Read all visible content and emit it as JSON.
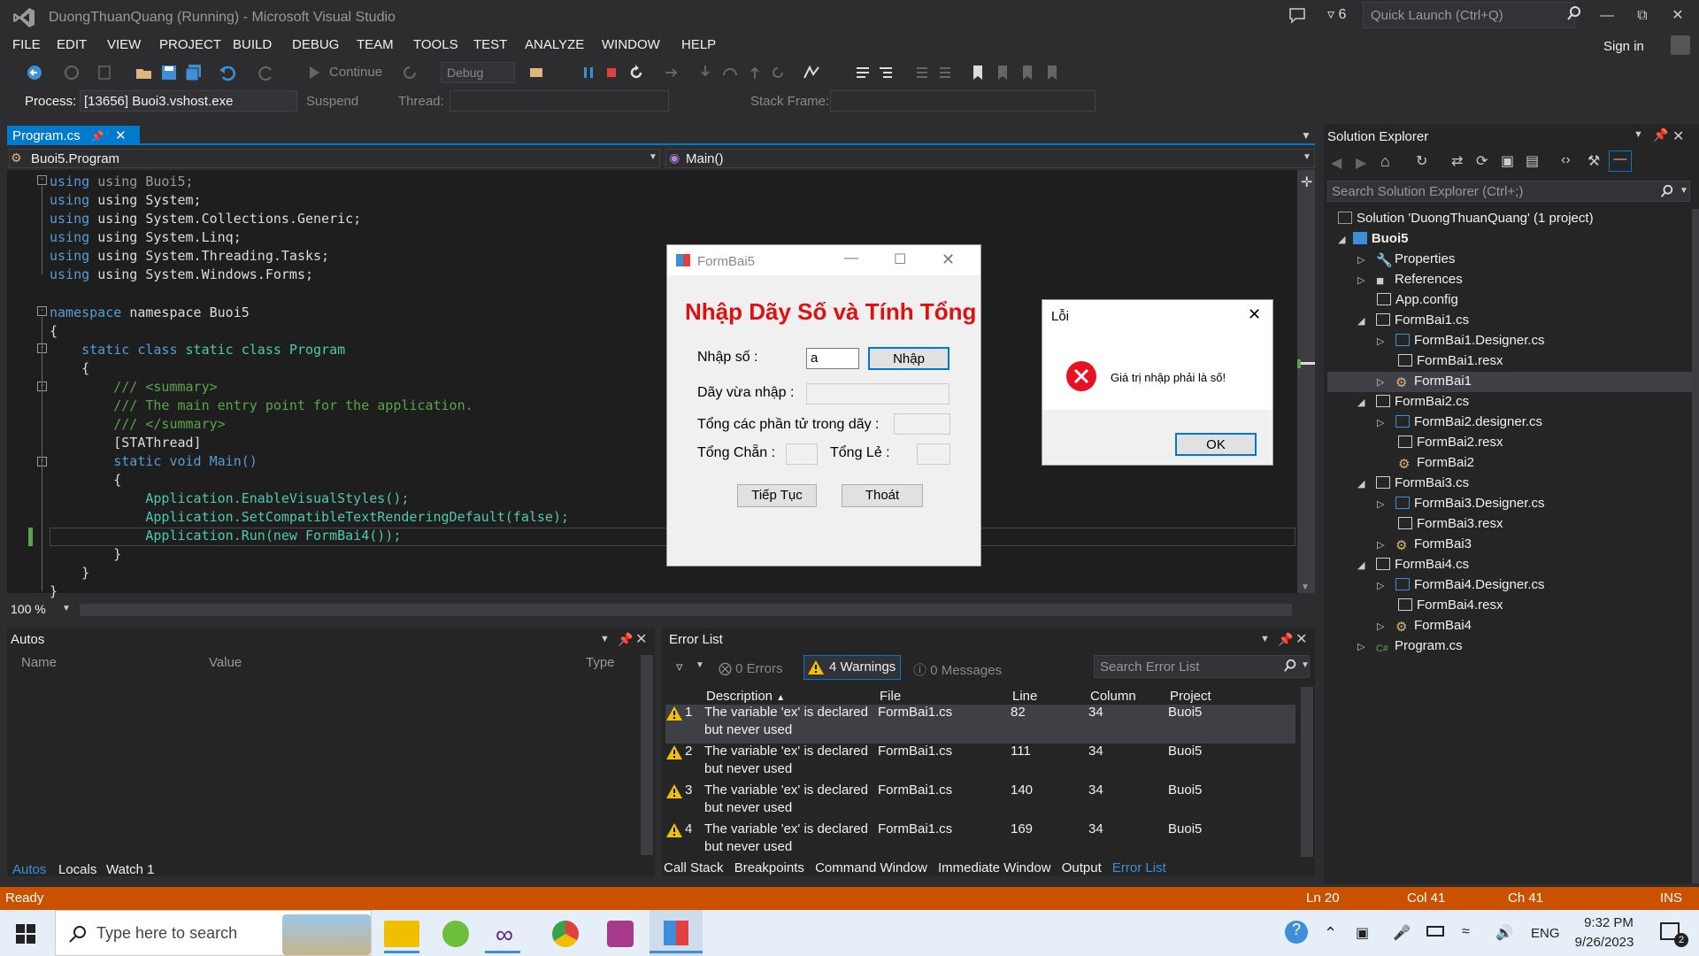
{
  "window": {
    "title": "DuongThuanQuang (Running) - Microsoft Visual Studio",
    "notification_count": "6",
    "quick_launch_placeholder": "Quick Launch (Ctrl+Q)",
    "sign_in": "Sign in"
  },
  "menu": [
    "FILE",
    "EDIT",
    "VIEW",
    "PROJECT",
    "BUILD",
    "DEBUG",
    "TEAM",
    "TOOLS",
    "TEST",
    "ANALYZE",
    "WINDOW",
    "HELP"
  ],
  "toolbar": {
    "continue_label": "Continue",
    "config": "Debug",
    "process_label": "Process:",
    "process_value": "[13656] Buoi3.vshost.exe",
    "suspend_label": "Suspend",
    "thread_label": "Thread:",
    "stack_frame_label": "Stack Frame:"
  },
  "editor": {
    "tab_label": "Program.cs",
    "nav_left": "Buoi5.Program",
    "nav_right": "Main()",
    "zoom": "100 %",
    "lines": {
      "l1": "using Buoi5;",
      "l2": "using System;",
      "l3": "using System.Collections.Generic;",
      "l4": "using System.Linq;",
      "l5": "using System.Threading.Tasks;",
      "l6": "using System.Windows.Forms;",
      "ns": "namespace Buoi5",
      "cls": "static class Program",
      "c1": "/// <summary>",
      "c2": "/// The main entry point for the application.",
      "c3": "/// </summary>",
      "attr": "[STAThread]",
      "main": "static void Main()",
      "a1": "Application.EnableVisualStyles();",
      "a2": "Application.SetCompatibleTextRenderingDefault(false);",
      "a3": "Application.Run(new FormBai4());"
    }
  },
  "formbai5": {
    "title": "FormBai5",
    "heading": "Nhập Dãy Số và Tính Tổng",
    "input_label": "Nhập số :",
    "input_value": "a",
    "enter_button": "Nhập",
    "entered_label": "Dãy vừa nhập :",
    "sum_label": "Tổng các phần tử trong dãy :",
    "even_label": "Tổng Chẵn :",
    "odd_label": "Tổng Lẻ :",
    "continue_button": "Tiếp Tục",
    "exit_button": "Thoát"
  },
  "error_dialog": {
    "title": "Lỗi",
    "message": "Giá trị nhập phải là số!",
    "ok_button": "OK"
  },
  "solution_explorer": {
    "title": "Solution Explorer",
    "search_placeholder": "Search Solution Explorer (Ctrl+;)",
    "solution": "Solution 'DuongThuanQuang' (1 project)",
    "project": "Buoi5",
    "items": {
      "properties": "Properties",
      "references": "References",
      "appconfig": "App.config",
      "f1": "FormBai1.cs",
      "f1d": "FormBai1.Designer.cs",
      "f1r": "FormBai1.resx",
      "f1c": "FormBai1",
      "f2": "FormBai2.cs",
      "f2d": "FormBai2.designer.cs",
      "f2r": "FormBai2.resx",
      "f2c": "FormBai2",
      "f3": "FormBai3.cs",
      "f3d": "FormBai3.Designer.cs",
      "f3r": "FormBai3.resx",
      "f3c": "FormBai3",
      "f4": "FormBai4.cs",
      "f4d": "FormBai4.Designer.cs",
      "f4r": "FormBai4.resx",
      "f4c": "FormBai4",
      "program": "Program.cs"
    }
  },
  "autos": {
    "title": "Autos",
    "columns": [
      "Name",
      "Value",
      "Type"
    ],
    "tabs": [
      "Autos",
      "Locals",
      "Watch 1"
    ]
  },
  "error_list": {
    "title": "Error List",
    "errors_label": "0 Errors",
    "warnings_label": "4 Warnings",
    "messages_label": "0 Messages",
    "search_placeholder": "Search Error List",
    "columns": [
      "Description",
      "File",
      "Line",
      "Column",
      "Project"
    ],
    "rows": [
      {
        "n": "1",
        "desc1": "The variable 'ex' is declared",
        "desc2": "but never used",
        "file": "FormBai1.cs",
        "line": "82",
        "col": "34",
        "project": "Buoi5"
      },
      {
        "n": "2",
        "desc1": "The variable 'ex' is declared",
        "desc2": "but never used",
        "file": "FormBai1.cs",
        "line": "111",
        "col": "34",
        "project": "Buoi5"
      },
      {
        "n": "3",
        "desc1": "The variable 'ex' is declared",
        "desc2": "but never used",
        "file": "FormBai1.cs",
        "line": "140",
        "col": "34",
        "project": "Buoi5"
      },
      {
        "n": "4",
        "desc1": "The variable 'ex' is declared",
        "desc2": "but never used",
        "file": "FormBai1.cs",
        "line": "169",
        "col": "34",
        "project": "Buoi5"
      }
    ],
    "bottom_tabs": [
      "Call Stack",
      "Breakpoints",
      "Command Window",
      "Immediate Window",
      "Output",
      "Error List"
    ]
  },
  "status": {
    "ready": "Ready",
    "ln": "Ln 20",
    "col": "Col 41",
    "ch": "Ch 41",
    "ins": "INS"
  },
  "taskbar": {
    "search_placeholder": "Type here to search",
    "lang": "ENG",
    "time": "9:32 PM",
    "date": "9/26/2023",
    "notif_count": "2"
  },
  "colors": {
    "accent": "#007acc",
    "status_bar": "#ca5100",
    "heading_red": "#e01010"
  }
}
